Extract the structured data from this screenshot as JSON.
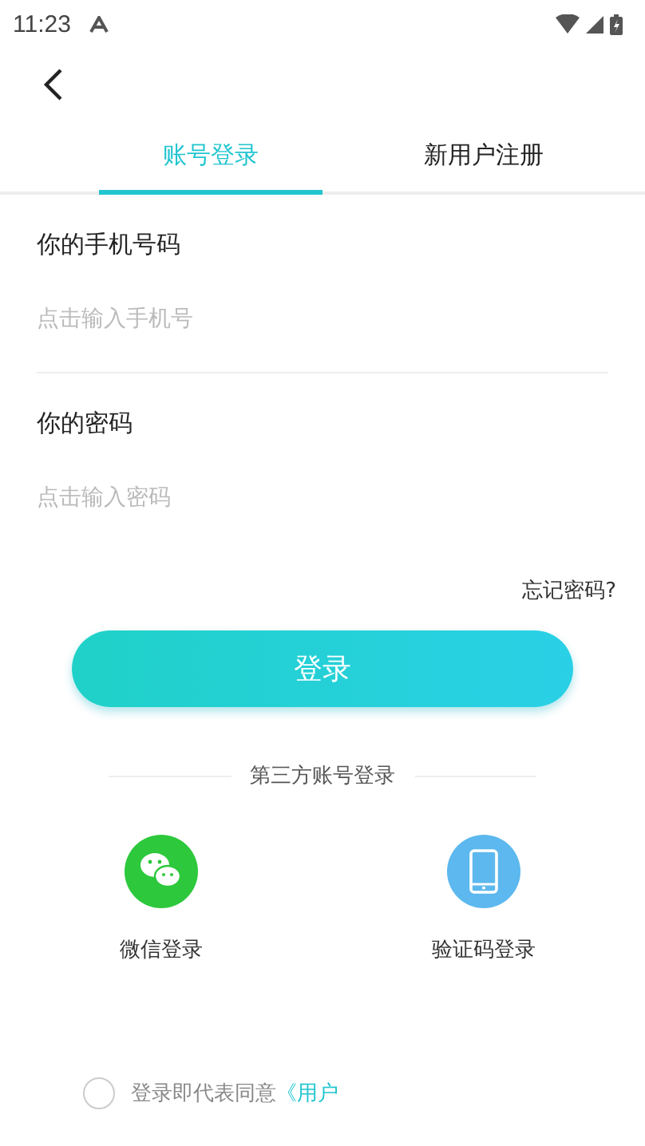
{
  "status_bar": {
    "time": "11:23"
  },
  "tabs": [
    {
      "label": "账号登录",
      "selected": true
    },
    {
      "label": "新用户注册",
      "selected": false
    }
  ],
  "fields": [
    {
      "label": "你的手机号码",
      "placeholder": "点击输入手机号"
    },
    {
      "label": "你的密码",
      "placeholder": "点击输入密码"
    }
  ],
  "forgot_password": "忘记密码?",
  "login_button": "登录",
  "third_party": {
    "title": "第三方账号登录",
    "options": [
      {
        "kind": "wechat",
        "label": "微信登录"
      },
      {
        "kind": "phone",
        "label": "验证码登录"
      }
    ]
  },
  "agreement": {
    "checked": false,
    "text": "登录即代表同意",
    "link": "《用户"
  }
}
